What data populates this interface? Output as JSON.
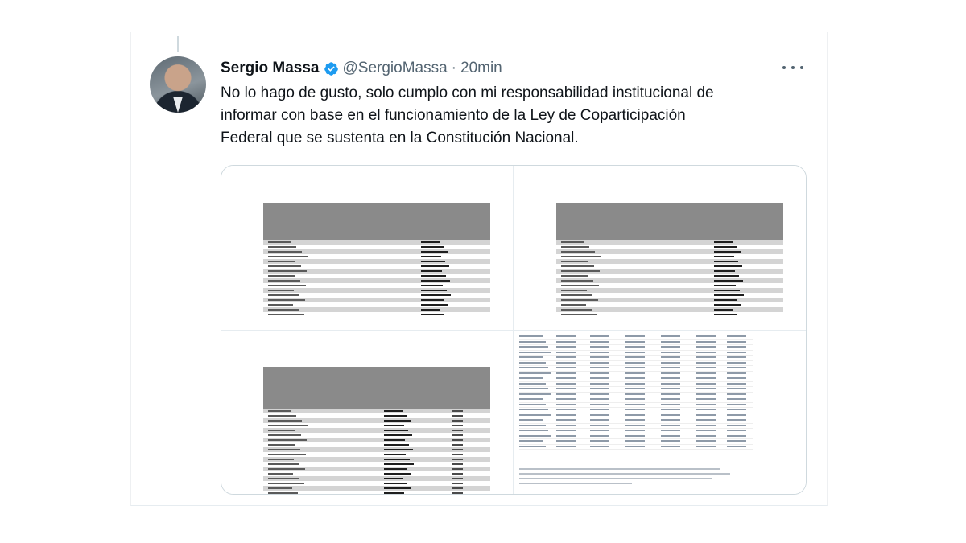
{
  "tweet": {
    "author_name": "Sergio Massa",
    "handle": "@SergioMassa",
    "separator": "·",
    "time": "20min",
    "verified": true,
    "text_lines": [
      "No lo hago de gusto, solo cumplo con mi responsabilidad institucional de",
      "informar con base en el funcionamiento de la Ley de Coparticipación",
      "Federal que se sustenta en la Constitución Nacional."
    ]
  },
  "icons": {
    "verified": "verified-badge-icon",
    "more": "more-options-icon"
  },
  "colors": {
    "verified_blue": "#1d9bf0",
    "name": "#0f1419",
    "secondary": "#536471",
    "table_header": "#8a8a8a",
    "table_stripe": "#d4d4d4"
  },
  "media": {
    "count": 4,
    "images": [
      {
        "id": "table-1",
        "kind": "table-image"
      },
      {
        "id": "table-2",
        "kind": "table-image"
      },
      {
        "id": "table-3",
        "kind": "table-image"
      },
      {
        "id": "table-4",
        "kind": "table-image"
      }
    ]
  }
}
